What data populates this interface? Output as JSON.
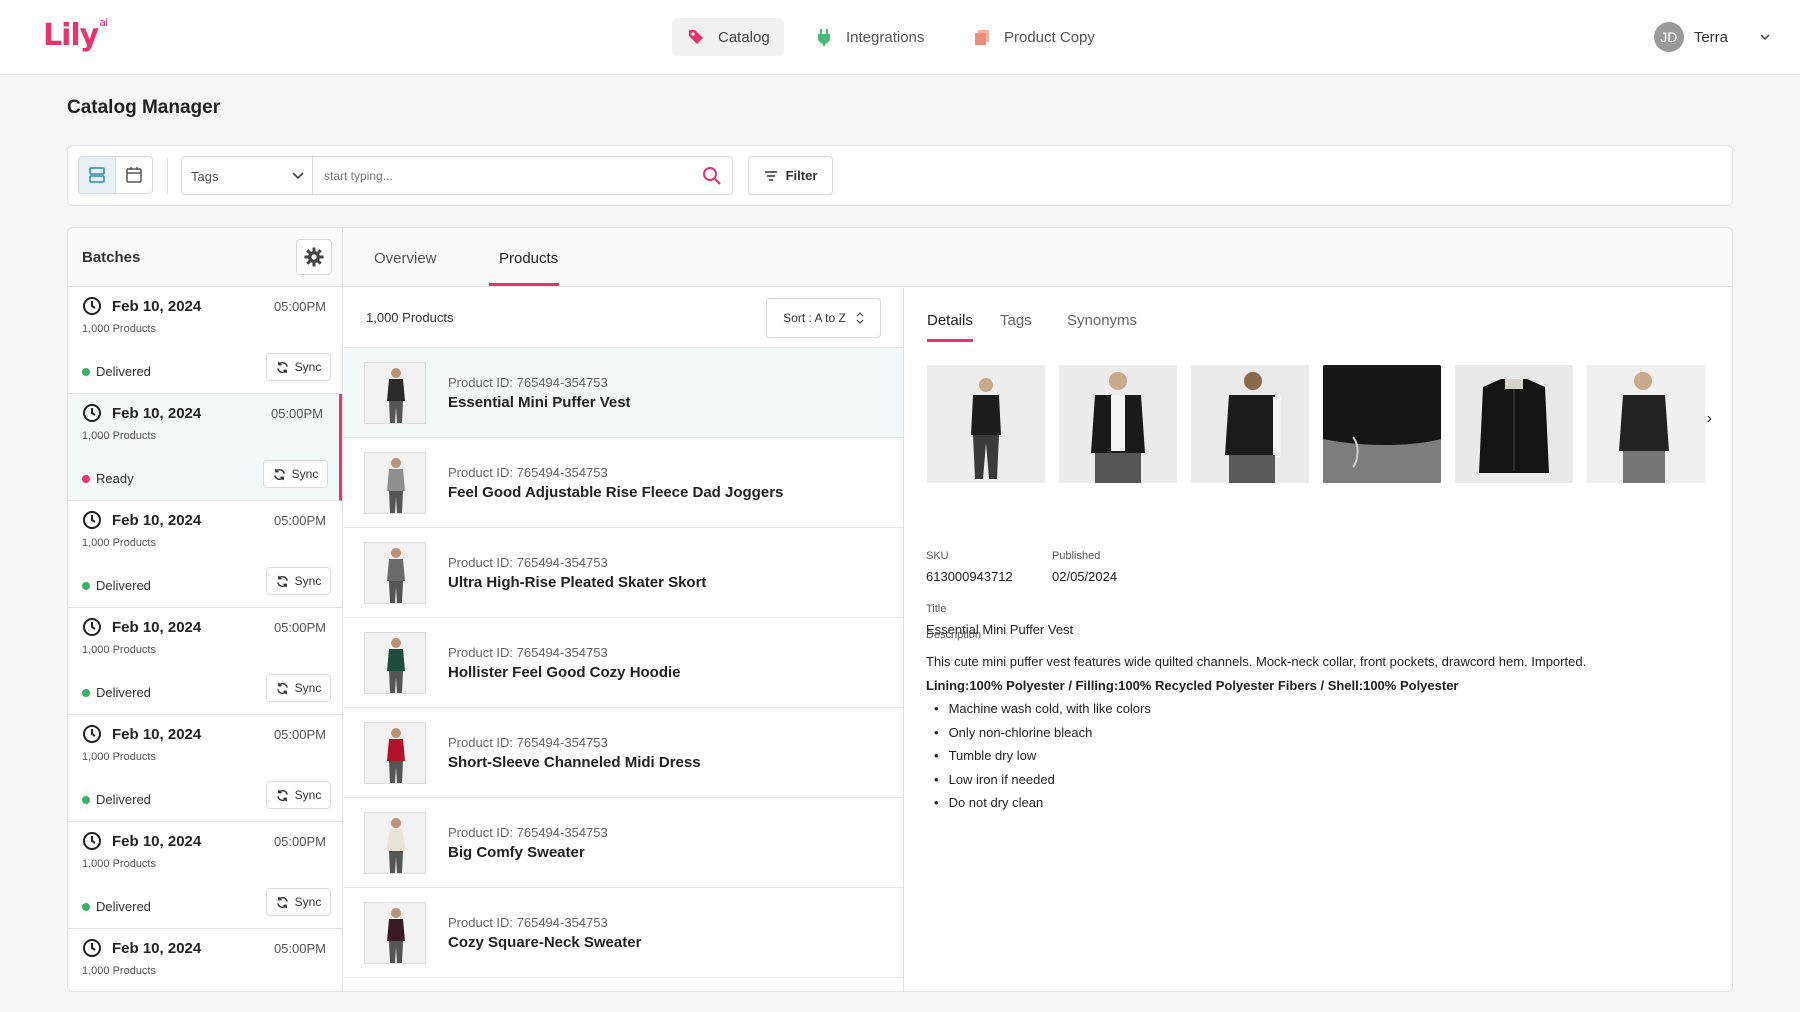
{
  "app": {
    "logo_text": "Lily",
    "logo_sup": "ai",
    "brand_color": "#e8336d"
  },
  "nav": [
    {
      "label": "Catalog",
      "icon": "tag-icon",
      "active": true
    },
    {
      "label": "Integrations",
      "icon": "plug-icon",
      "active": false
    },
    {
      "label": "Product Copy",
      "icon": "copy-icon",
      "active": false
    }
  ],
  "user": {
    "initials": "JD",
    "name": "Terra"
  },
  "page": {
    "title": "Catalog Manager"
  },
  "toolbar": {
    "tags_label": "Tags",
    "search_placeholder": "start typing...",
    "filter_label": "Filter"
  },
  "batches": {
    "title": "Batches",
    "items": [
      {
        "date": "Feb 10, 2024",
        "time": "05:00PM",
        "count": "1,000 Products",
        "status": "Delivered",
        "status_color": "#3bb06a",
        "sync": "Sync"
      },
      {
        "date": "Feb 10, 2024",
        "time": "05:00PM",
        "count": "1,000 Products",
        "status": "Ready",
        "status_color": "#e8336d",
        "sync": "Sync"
      },
      {
        "date": "Feb 10, 2024",
        "time": "05:00PM",
        "count": "1,000 Products",
        "status": "Delivered",
        "status_color": "#3bb06a",
        "sync": "Sync"
      },
      {
        "date": "Feb 10, 2024",
        "time": "05:00PM",
        "count": "1,000 Products",
        "status": "Delivered",
        "status_color": "#3bb06a",
        "sync": "Sync"
      },
      {
        "date": "Feb 10, 2024",
        "time": "05:00PM",
        "count": "1,000 Products",
        "status": "Delivered",
        "status_color": "#3bb06a",
        "sync": "Sync"
      },
      {
        "date": "Feb 10, 2024",
        "time": "05:00PM",
        "count": "1,000 Products",
        "status": "Delivered",
        "status_color": "#3bb06a",
        "sync": "Sync"
      },
      {
        "date": "Feb 10, 2024",
        "time": "05:00PM",
        "count": "1,000 Products",
        "status": "",
        "status_color": "#3bb06a",
        "sync": ""
      }
    ]
  },
  "tabs": {
    "overview": "Overview",
    "products": "Products"
  },
  "products": {
    "count_label": "1,000 Products",
    "sort_label": "Sort : A to Z",
    "items": [
      {
        "id": "Product ID: 765494-354753",
        "name": "Essential Mini Puffer Vest",
        "thumb_color": "#2a2a2a"
      },
      {
        "id": "Product ID: 765494-354753",
        "name": "Feel Good Adjustable Rise Fleece Dad Joggers",
        "thumb_color": "#8e8e8e"
      },
      {
        "id": "Product ID: 765494-354753",
        "name": "Ultra High-Rise Pleated Skater Skort",
        "thumb_color": "#6b6b6b"
      },
      {
        "id": "Product ID: 765494-354753",
        "name": "Hollister Feel Good Cozy Hoodie",
        "thumb_color": "#1f4a3e"
      },
      {
        "id": "Product ID: 765494-354753",
        "name": "Short-Sleeve Channeled Midi Dress",
        "thumb_color": "#b3122c"
      },
      {
        "id": "Product ID: 765494-354753",
        "name": "Big Comfy Sweater",
        "thumb_color": "#e8e3d6"
      },
      {
        "id": "Product ID: 765494-354753",
        "name": "Cozy Square-Neck Sweater",
        "thumb_color": "#3a1a22"
      }
    ]
  },
  "details": {
    "tabs": [
      "Details",
      "Tags",
      "Synonyms"
    ],
    "sku_label": "SKU",
    "sku": "613000943712",
    "published_label": "Published",
    "published": "02/05/2024",
    "title_label": "Title",
    "title": "Essential Mini Puffer Vest",
    "description_label": "Description",
    "description": "This cute mini puffer vest features wide quilted channels. Mock-neck collar, front pockets, drawcord hem. Imported.",
    "materials": "Lining:100% Polyester / Filling:100% Recycled Polyester Fibers / Shell:100% Polyester",
    "care": [
      "Machine wash cold, with like colors",
      "Only non-chlorine bleach",
      "Tumble dry low",
      "Low iron if needed",
      "Do not dry clean"
    ]
  }
}
